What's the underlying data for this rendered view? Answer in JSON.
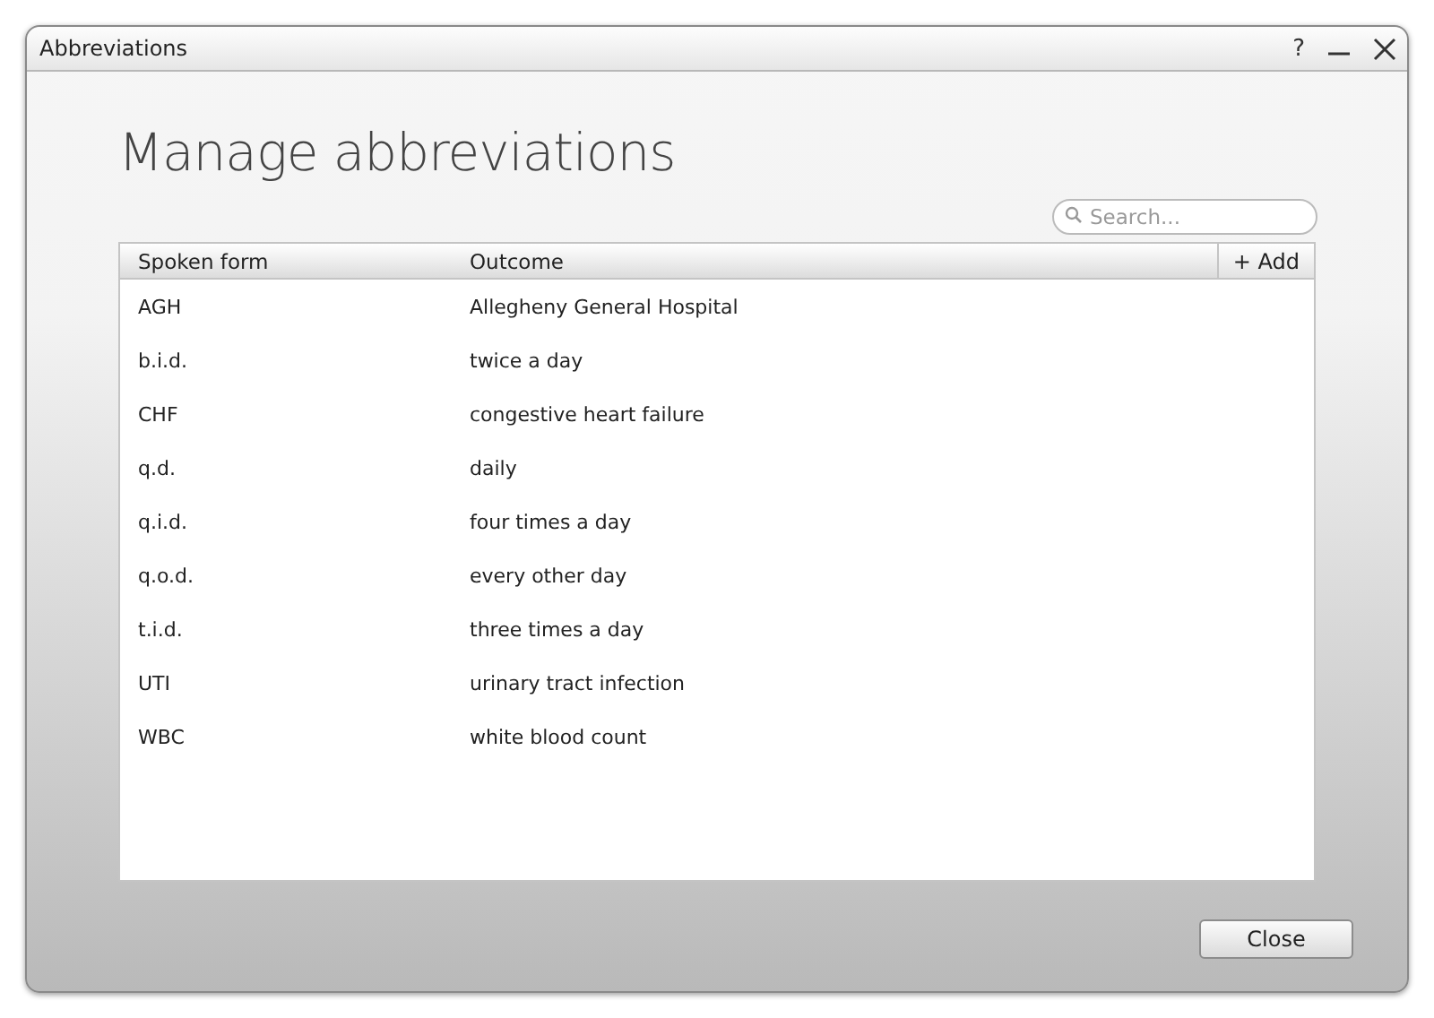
{
  "window": {
    "title": "Abbreviations",
    "help": "?"
  },
  "heading": "Manage abbreviations",
  "search": {
    "placeholder": "Search..."
  },
  "table": {
    "columns": [
      "Spoken form",
      "Outcome"
    ],
    "add": "+ Add",
    "rows": [
      {
        "spoken": "AGH",
        "outcome": "Allegheny General Hospital"
      },
      {
        "spoken": "b.i.d.",
        "outcome": "twice a day"
      },
      {
        "spoken": "CHF",
        "outcome": "congestive heart failure"
      },
      {
        "spoken": "q.d.",
        "outcome": "daily"
      },
      {
        "spoken": "q.i.d.",
        "outcome": "four times a day"
      },
      {
        "spoken": "q.o.d.",
        "outcome": "every other day"
      },
      {
        "spoken": "t.i.d.",
        "outcome": "three times a day"
      },
      {
        "spoken": "UTI",
        "outcome": "urinary tract infection"
      },
      {
        "spoken": "WBC",
        "outcome": "white blood count"
      }
    ]
  },
  "buttons": [
    "Close"
  ]
}
